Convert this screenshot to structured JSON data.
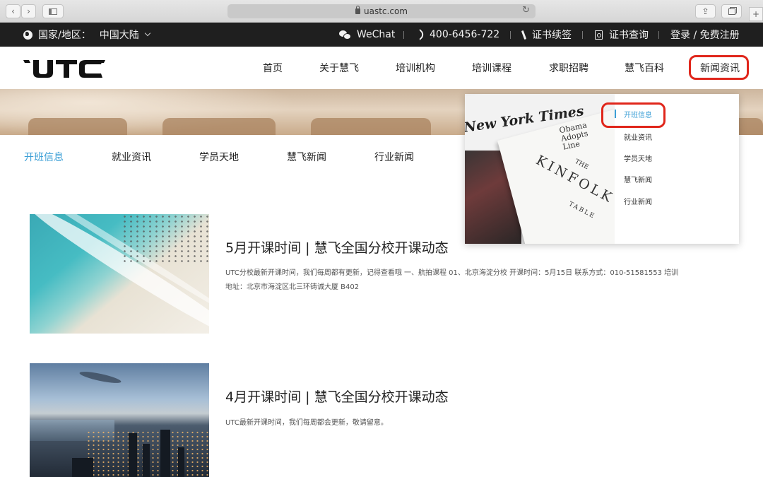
{
  "browser": {
    "url": "uastc.com"
  },
  "topbar": {
    "region_label": "国家/地区：",
    "region_value": "中国大陆",
    "wechat": "WeChat",
    "phone": "400-6456-722",
    "cert_renew": "证书续签",
    "cert_query": "证书查询",
    "login_register": "登录 / 免费注册"
  },
  "header": {
    "logo": "UTC",
    "nav": [
      {
        "label": "首页"
      },
      {
        "label": "关于慧飞"
      },
      {
        "label": "培训机构"
      },
      {
        "label": "培训课程"
      },
      {
        "label": "求职招聘"
      },
      {
        "label": "慧飞百科"
      },
      {
        "label": "新闻资讯"
      }
    ],
    "active_nav": "新闻资讯",
    "highlight_color": "#e0261b"
  },
  "subtabs": [
    {
      "label": "开班信息",
      "active": true
    },
    {
      "label": "就业资讯",
      "active": false
    },
    {
      "label": "学员天地",
      "active": false
    },
    {
      "label": "慧飞新闻",
      "active": false
    },
    {
      "label": "行业新闻",
      "active": false
    }
  ],
  "accent_color": "#3c9fd6",
  "articles": [
    {
      "title": "5月开课时间 | 慧飞全国分校开课动态",
      "desc": "UTC分校最新开课时间，我们每周都有更新，记得查看哦 一、航拍课程 01、北京海淀分校 开课时间：5月15日 联系方式：010-51581553 培训地址：北京市海淀区北三环铸诚大厦 B402",
      "image": "beach-aerial-image"
    },
    {
      "title": "4月开课时间 | 慧飞全国分校开课动态",
      "desc": "UTC最新开课时间，我们每周都会更新，敬请留意。",
      "image": "city-night-image"
    }
  ],
  "dropdown": {
    "image_text": {
      "newspaper": "New York Times",
      "headline": "Obama\nAdopts\nLine",
      "the": "THE",
      "magazine": "KINFOLK",
      "table": "TABLE"
    },
    "items": [
      {
        "label": "开班信息",
        "active": true
      },
      {
        "label": "就业资讯",
        "active": false
      },
      {
        "label": "学员天地",
        "active": false
      },
      {
        "label": "慧飞新闻",
        "active": false
      },
      {
        "label": "行业新闻",
        "active": false
      }
    ]
  }
}
